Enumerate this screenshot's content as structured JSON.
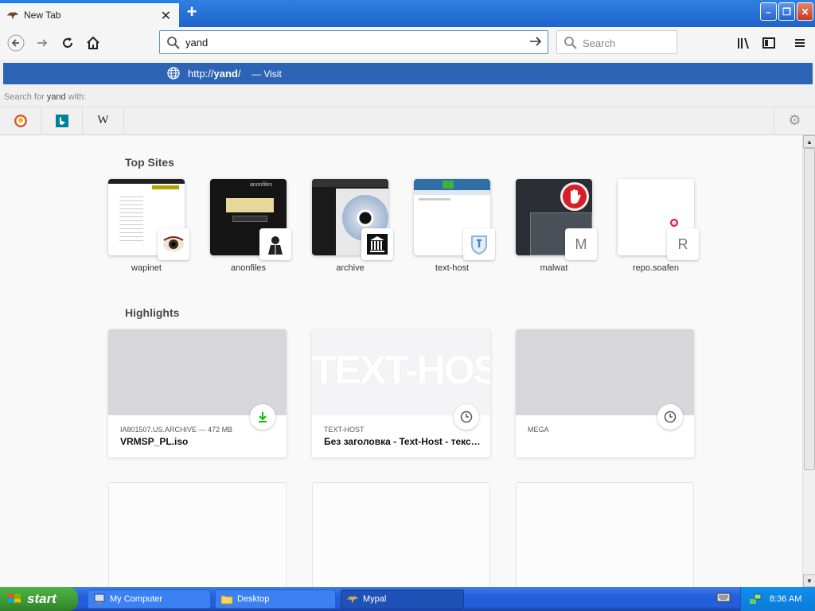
{
  "browser": {
    "tab": {
      "title": "New Tab",
      "close": "✕"
    },
    "new_tab": "+",
    "window_buttons": {
      "minimize": "–",
      "maximize": "❐",
      "close": "✕"
    }
  },
  "navbar": {
    "url_value": "yand",
    "search_placeholder": "Search"
  },
  "autocomplete": {
    "url_prefix": "http://",
    "url_bold": "yand",
    "url_suffix": "/",
    "visit": "— Visit",
    "search_for_prefix": "Search for",
    "search_for_term": "yand",
    "search_for_suffix": "with:",
    "engines": [
      "duckduckgo-icon",
      "bing-icon",
      "wikipedia-icon"
    ],
    "wikipedia_glyph": "W"
  },
  "content": {
    "top_sites_title": "Top Sites",
    "top_sites": [
      {
        "label": "wapinet",
        "badge": ""
      },
      {
        "label": "anonfiles",
        "badge": ""
      },
      {
        "label": "archive",
        "badge": ""
      },
      {
        "label": "text-host",
        "badge": ""
      },
      {
        "label": "malwat",
        "badge": "M"
      },
      {
        "label": "repo.soafen",
        "badge": "R"
      }
    ],
    "highlights_title": "Highlights",
    "highlights": [
      {
        "context": "IA801507.US.ARCHIVE — 472 MB",
        "title": "VRMSP_PL.iso",
        "icon": "download-icon"
      },
      {
        "context": "TEXT-HOST",
        "title": "Без заголовка - Text-Host - текстовый хостинг",
        "icon": "clock-icon",
        "image_text": "TEXT-HOST"
      },
      {
        "context": "MEGA",
        "title": "",
        "icon": "clock-icon"
      }
    ]
  },
  "taskbar": {
    "start": "start",
    "tasks": [
      {
        "label": "My Computer"
      },
      {
        "label": "Desktop"
      },
      {
        "label": "Mypal"
      }
    ],
    "clock": "8:36 AM"
  },
  "colors": {
    "suggest_bg": "#2e64b5",
    "accent": "#0a84ff",
    "taskbar": "#245edb",
    "start": "#3c9a35"
  }
}
